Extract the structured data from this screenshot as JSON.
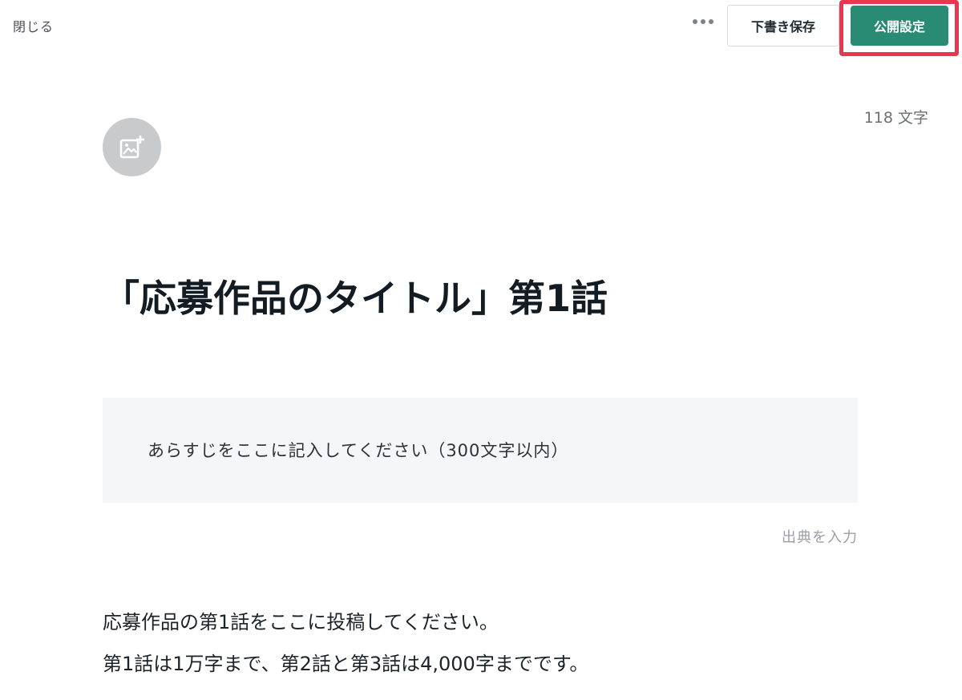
{
  "header": {
    "close_label": "閉じる",
    "more_icon": "more-horizontal-icon",
    "draft_save_label": "下書き保存",
    "publish_settings_label": "公開設定",
    "publish_color": "#2a8b74",
    "highlight_color": "#e8374f"
  },
  "editor": {
    "char_count_value": "118",
    "char_count_unit": "文字",
    "image_add_icon": "image-add-icon",
    "title": "「応募作品のタイトル」第1話",
    "synopsis_placeholder": "あらすじをここに記入してください（300文字以内）",
    "source_label": "出典を入力",
    "body_lines": [
      "応募作品の第1話をここに投稿してください。",
      "第1話は1万字まで、第2話と第3話は4,000字までです。"
    ]
  }
}
